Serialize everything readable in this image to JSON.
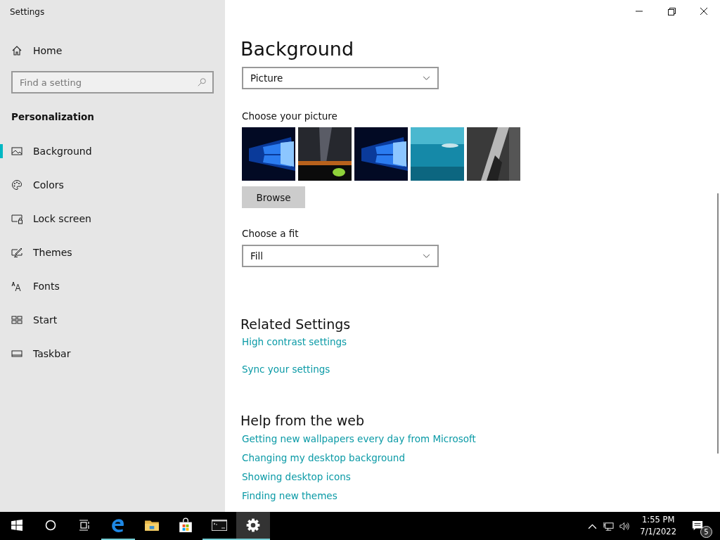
{
  "window": {
    "title": "Settings"
  },
  "sidebar": {
    "home": "Home",
    "search": {
      "placeholder": "Find a setting"
    },
    "section": "Personalization",
    "items": [
      {
        "label": "Background",
        "kind": "background",
        "selected": true
      },
      {
        "label": "Colors",
        "kind": "colors",
        "selected": false
      },
      {
        "label": "Lock screen",
        "kind": "lock",
        "selected": false
      },
      {
        "label": "Themes",
        "kind": "themes",
        "selected": false
      },
      {
        "label": "Fonts",
        "kind": "fonts",
        "selected": false
      },
      {
        "label": "Start",
        "kind": "start",
        "selected": false
      },
      {
        "label": "Taskbar",
        "kind": "taskbar",
        "selected": false
      }
    ]
  },
  "main": {
    "title": "Background",
    "background_dropdown": {
      "value": "Picture"
    },
    "pictures_label": "Choose your picture",
    "browse_button": "Browse",
    "fit_label": "Choose a fit",
    "fit_dropdown": {
      "value": "Fill"
    },
    "related": {
      "title": "Related Settings",
      "links": [
        "High contrast settings",
        "Sync your settings"
      ]
    },
    "help": {
      "title": "Help from the web",
      "links": [
        "Getting new wallpapers every day from Microsoft",
        "Changing my desktop background",
        "Showing desktop icons",
        "Finding new themes"
      ]
    }
  },
  "taskbar": {
    "apps": [
      {
        "kind": "start",
        "running": false,
        "selected": false
      },
      {
        "kind": "search",
        "running": false,
        "selected": false
      },
      {
        "kind": "taskview",
        "running": false,
        "selected": false
      },
      {
        "kind": "browser",
        "running": true,
        "selected": false
      },
      {
        "kind": "folder",
        "running": false,
        "selected": false
      },
      {
        "kind": "store",
        "running": false,
        "selected": false
      },
      {
        "kind": "terminal",
        "running": true,
        "selected": false
      },
      {
        "kind": "settings",
        "running": true,
        "selected": true
      }
    ],
    "time": "1:55 PM",
    "date": "7/1/2022",
    "notifications": "5"
  }
}
